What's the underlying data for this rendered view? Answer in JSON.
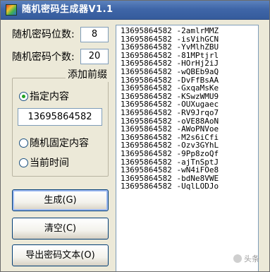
{
  "window": {
    "title": "随机密码生成器V1.1"
  },
  "settings": {
    "digits_label": "随机密码位数:",
    "digits_value": "8",
    "count_label": "随机密码个数:",
    "count_value": "20"
  },
  "prefix_group": {
    "legend": "添加前缀",
    "options": [
      {
        "label": "指定内容",
        "checked": true
      },
      {
        "label": "随机固定内容",
        "checked": false
      },
      {
        "label": "当前时间",
        "checked": false
      }
    ],
    "prefix_value": "13695864582"
  },
  "buttons": {
    "generate": "生成(G)",
    "clear": "清空(C)",
    "export": "导出密码文本(O)"
  },
  "output_lines": [
    "13695864582 -2amlrMMZ",
    "13695864582 -isVihGCN",
    "13695864582 -YvMlhZBU",
    "13695864582 -81MPtjrl",
    "13695864582 -HOrHj2iJ",
    "13695864582 -wQBEb9aQ",
    "13695864582 -DvFfBsAA",
    "13695864582 -GxqaMsKe",
    "13695864582 -KSwzWMU9",
    "13695864582 -OUXugaec",
    "13695864582 -RV9Jrqo7",
    "13695864582 -oVE88AoN",
    "13695864582 -AWoPNVoe",
    "13695864582 -M2s6iCfi",
    "13695864582 -Ozv3GYhL",
    "13695864582 -9Pp8zoQf",
    "13695864582 -ajTnSptJ",
    "13695864582 -wN4iFOe8",
    "13695864582 -bdNe8VWE",
    "13695864582 -UqlLODJo"
  ],
  "watermark": "头条"
}
